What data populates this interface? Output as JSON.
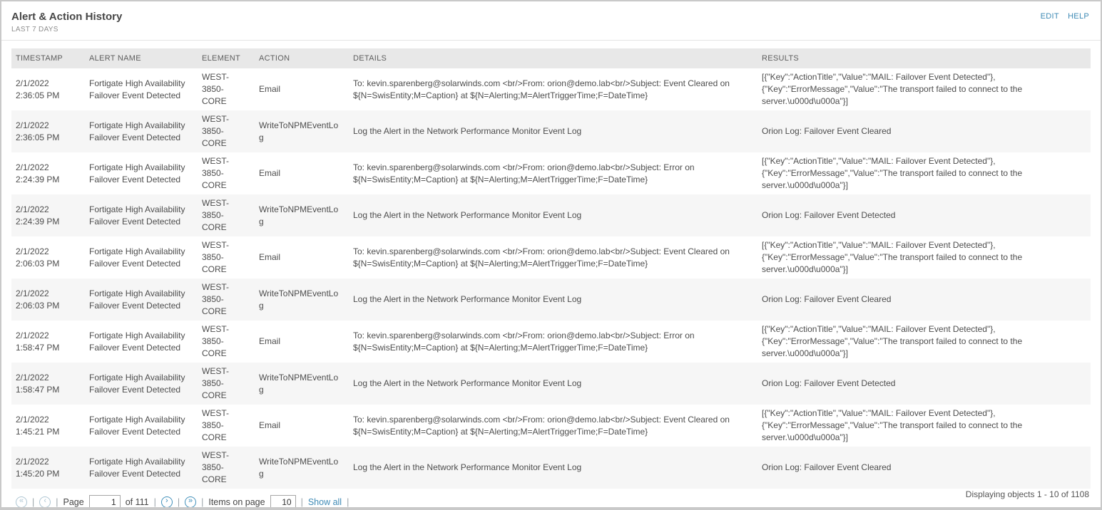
{
  "header": {
    "title": "Alert & Action History",
    "subtitle": "LAST 7 DAYS",
    "edit_label": "EDIT",
    "help_label": "HELP"
  },
  "table": {
    "columns": [
      "TIMESTAMP",
      "ALERT NAME",
      "ELEMENT",
      "ACTION",
      "DETAILS",
      "RESULTS"
    ],
    "rows": [
      {
        "timestamp": "2/1/2022 2:36:05 PM",
        "alert_name": "Fortigate High Availability Failover Event Detected",
        "element": "WEST-3850-CORE",
        "action": "Email",
        "details": "To: kevin.sparenberg@solarwinds.com <br/>From: orion@demo.lab<br/>Subject: Event Cleared on ${N=SwisEntity;M=Caption} at ${N=Alerting;M=AlertTriggerTime;F=DateTime}",
        "results": "[{\"Key\":\"ActionTitle\",\"Value\":\"MAIL: Failover Event Detected\"}, {\"Key\":\"ErrorMessage\",\"Value\":\"The transport failed to connect to the server.\\u000d\\u000a\"}]"
      },
      {
        "timestamp": "2/1/2022 2:36:05 PM",
        "alert_name": "Fortigate High Availability Failover Event Detected",
        "element": "WEST-3850-CORE",
        "action": "WriteToNPMEventLog",
        "details": "Log the Alert in the Network Performance Monitor Event Log",
        "results": "Orion Log: Failover Event Cleared"
      },
      {
        "timestamp": "2/1/2022 2:24:39 PM",
        "alert_name": "Fortigate High Availability Failover Event Detected",
        "element": "WEST-3850-CORE",
        "action": "Email",
        "details": "To: kevin.sparenberg@solarwinds.com <br/>From: orion@demo.lab<br/>Subject: Error on ${N=SwisEntity;M=Caption} at ${N=Alerting;M=AlertTriggerTime;F=DateTime}",
        "results": "[{\"Key\":\"ActionTitle\",\"Value\":\"MAIL: Failover Event Detected\"}, {\"Key\":\"ErrorMessage\",\"Value\":\"The transport failed to connect to the server.\\u000d\\u000a\"}]"
      },
      {
        "timestamp": "2/1/2022 2:24:39 PM",
        "alert_name": "Fortigate High Availability Failover Event Detected",
        "element": "WEST-3850-CORE",
        "action": "WriteToNPMEventLog",
        "details": "Log the Alert in the Network Performance Monitor Event Log",
        "results": "Orion Log: Failover Event Detected"
      },
      {
        "timestamp": "2/1/2022 2:06:03 PM",
        "alert_name": "Fortigate High Availability Failover Event Detected",
        "element": "WEST-3850-CORE",
        "action": "Email",
        "details": "To: kevin.sparenberg@solarwinds.com <br/>From: orion@demo.lab<br/>Subject: Event Cleared on ${N=SwisEntity;M=Caption} at ${N=Alerting;M=AlertTriggerTime;F=DateTime}",
        "results": "[{\"Key\":\"ActionTitle\",\"Value\":\"MAIL: Failover Event Detected\"}, {\"Key\":\"ErrorMessage\",\"Value\":\"The transport failed to connect to the server.\\u000d\\u000a\"}]"
      },
      {
        "timestamp": "2/1/2022 2:06:03 PM",
        "alert_name": "Fortigate High Availability Failover Event Detected",
        "element": "WEST-3850-CORE",
        "action": "WriteToNPMEventLog",
        "details": "Log the Alert in the Network Performance Monitor Event Log",
        "results": "Orion Log: Failover Event Cleared"
      },
      {
        "timestamp": "2/1/2022 1:58:47 PM",
        "alert_name": "Fortigate High Availability Failover Event Detected",
        "element": "WEST-3850-CORE",
        "action": "Email",
        "details": "To: kevin.sparenberg@solarwinds.com <br/>From: orion@demo.lab<br/>Subject: Error on ${N=SwisEntity;M=Caption} at ${N=Alerting;M=AlertTriggerTime;F=DateTime}",
        "results": "[{\"Key\":\"ActionTitle\",\"Value\":\"MAIL: Failover Event Detected\"}, {\"Key\":\"ErrorMessage\",\"Value\":\"The transport failed to connect to the server.\\u000d\\u000a\"}]"
      },
      {
        "timestamp": "2/1/2022 1:58:47 PM",
        "alert_name": "Fortigate High Availability Failover Event Detected",
        "element": "WEST-3850-CORE",
        "action": "WriteToNPMEventLog",
        "details": "Log the Alert in the Network Performance Monitor Event Log",
        "results": "Orion Log: Failover Event Detected"
      },
      {
        "timestamp": "2/1/2022 1:45:21 PM",
        "alert_name": "Fortigate High Availability Failover Event Detected",
        "element": "WEST-3850-CORE",
        "action": "Email",
        "details": "To: kevin.sparenberg@solarwinds.com <br/>From: orion@demo.lab<br/>Subject: Event Cleared on ${N=SwisEntity;M=Caption} at ${N=Alerting;M=AlertTriggerTime;F=DateTime}",
        "results": "[{\"Key\":\"ActionTitle\",\"Value\":\"MAIL: Failover Event Detected\"}, {\"Key\":\"ErrorMessage\",\"Value\":\"The transport failed to connect to the server.\\u000d\\u000a\"}]"
      },
      {
        "timestamp": "2/1/2022 1:45:20 PM",
        "alert_name": "Fortigate High Availability Failover Event Detected",
        "element": "WEST-3850-CORE",
        "action": "WriteToNPMEventLog",
        "details": "Log the Alert in the Network Performance Monitor Event Log",
        "results": "Orion Log: Failover Event Cleared"
      }
    ]
  },
  "pagination": {
    "first_icon": "«",
    "prev_icon": "‹",
    "next_icon": "›",
    "last_icon": "»",
    "separator": "|",
    "page_label": "Page",
    "page_value": "1",
    "of_label": "of 111",
    "items_label": "Items on page",
    "items_value": "10",
    "show_all_label": "Show all"
  },
  "footer": {
    "displaying_label": "Displaying objects 1 - 10 of 1108"
  },
  "colors": {
    "accent_link": "#3e8ab5",
    "header_row_bg": "#e8e8e8",
    "alt_row_bg": "#f6f6f6",
    "disabled_pager": "#aec6d3",
    "enabled_pager": "#4190ba",
    "frame_border": "#c9c9c9"
  }
}
